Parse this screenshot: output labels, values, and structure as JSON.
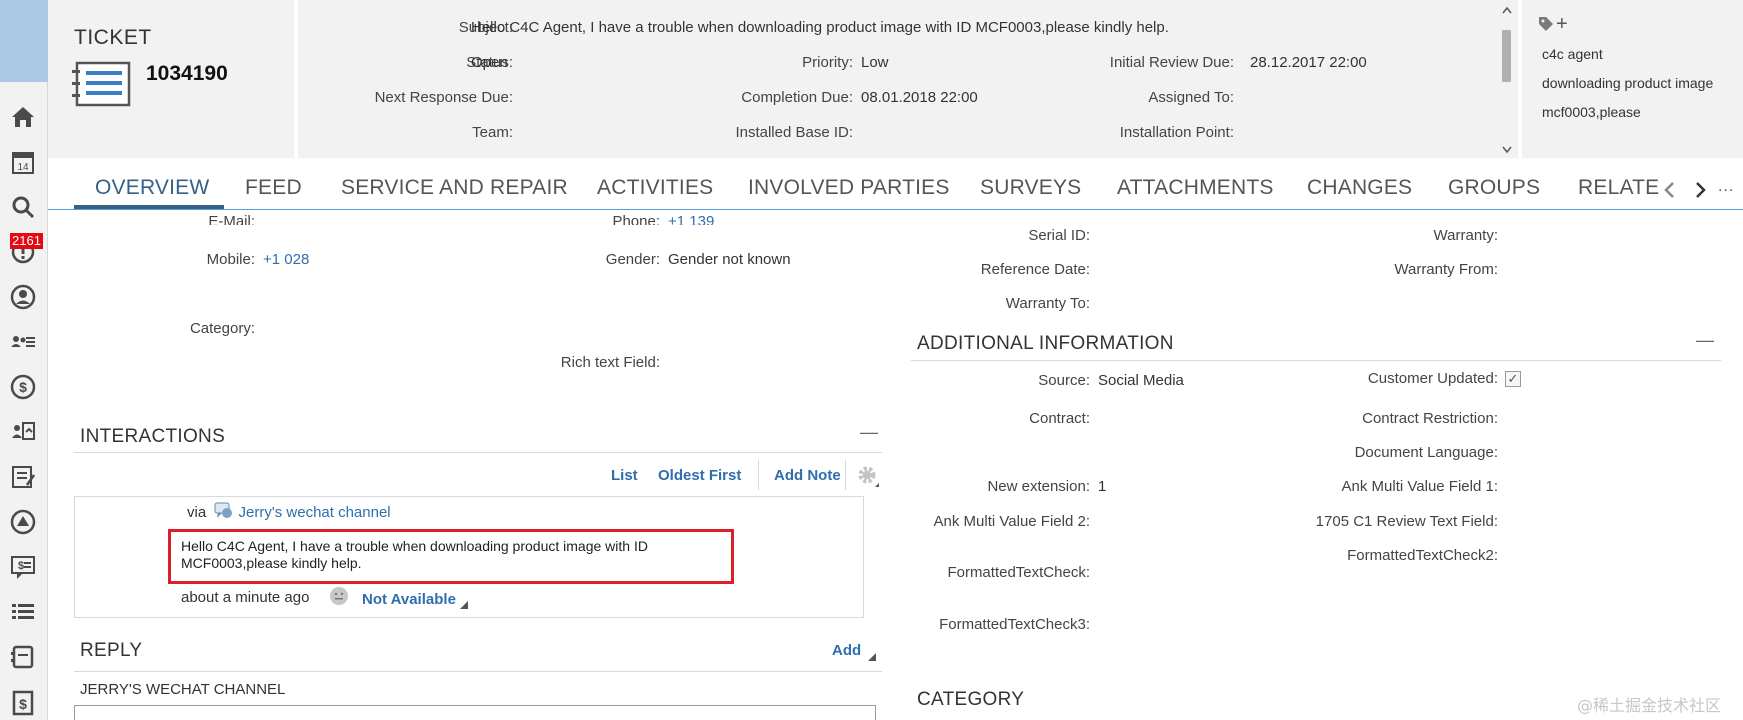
{
  "left_nav": {
    "badge": "2161",
    "icons": [
      "home-icon",
      "calendar-icon",
      "search-icon",
      "alert-icon",
      "account-icon",
      "contacts-list-icon",
      "currency-icon",
      "activities-icon",
      "tasks-icon",
      "service-icon",
      "quotes-icon",
      "list-icon",
      "products-icon",
      "pricing-icon"
    ],
    "calendar_day": "14"
  },
  "header": {
    "ticket_label": "TICKET",
    "ticket_id": "1034190",
    "subject_label": "Subject:",
    "subject_value": "Hello C4C Agent, I have a trouble when downloading product image with ID MCF0003,please kindly help.",
    "status_label": "Status:",
    "status_value": "Open",
    "priority_label": "Priority:",
    "priority_value": "Low",
    "initial_review_label": "Initial Review Due:",
    "initial_review_value": "28.12.2017 22:00",
    "next_response_label": "Next Response Due:",
    "completion_label": "Completion Due:",
    "completion_value": "08.01.2018 22:00",
    "assigned_label": "Assigned To:",
    "team_label": "Team:",
    "installed_base_label": "Installed Base ID:",
    "installation_point_label": "Installation Point:",
    "tags": [
      "c4c agent",
      "downloading product image",
      "mcf0003,please"
    ],
    "tag_add": "+"
  },
  "tabs": {
    "items": [
      "OVERVIEW",
      "FEED",
      "SERVICE AND REPAIR",
      "ACTIVITIES",
      "INVOLVED PARTIES",
      "SURVEYS",
      "ATTACHMENTS",
      "CHANGES",
      "GROUPS",
      "RELATE"
    ],
    "active": "OVERVIEW",
    "more": "..."
  },
  "contact": {
    "email_label": "E-Mail:",
    "phone_label": "Phone:",
    "phone_value": "+1 139",
    "mobile_label": "Mobile:",
    "mobile_value": "+1 028",
    "gender_label": "Gender:",
    "gender_value": "Gender not known",
    "category_label": "Category:",
    "rich_text_label": "Rich text Field:"
  },
  "interactions": {
    "title": "INTERACTIONS",
    "collapse": "—",
    "list": "List",
    "oldest_first": "Oldest First",
    "add_note": "Add Note",
    "via": "via",
    "channel": "Jerry's wechat channel",
    "message": "Hello C4C Agent, I have a trouble when downloading product image with ID MCF0003,please kindly help.",
    "time": "about a minute ago",
    "availability": "Not Available"
  },
  "reply": {
    "title": "REPLY",
    "add": "Add",
    "channel": "JERRY'S WECHAT CHANNEL"
  },
  "right_fields": {
    "serial_id_label": "Serial ID:",
    "warranty_label": "Warranty:",
    "reference_date_label": "Reference Date:",
    "warranty_from_label": "Warranty From:",
    "warranty_to_label": "Warranty To:"
  },
  "additional_info": {
    "title": "ADDITIONAL INFORMATION",
    "collapse": "—",
    "source_label": "Source:",
    "source_value": "Social Media",
    "customer_updated_label": "Customer Updated:",
    "customer_updated_checked": "✓",
    "contract_label": "Contract:",
    "contract_restriction_label": "Contract Restriction:",
    "document_language_label": "Document Language:",
    "new_extension_label": "New extension:",
    "new_extension_value": "1",
    "ank_multi_1_label": "Ank Multi Value Field 1:",
    "ank_multi_2_label": "Ank Multi Value Field 2:",
    "review_text_label": "1705 C1 Review Text Field:",
    "formatted_text_check2_label": "FormattedTextCheck2:",
    "formatted_text_check_label": "FormattedTextCheck:",
    "formatted_text_check3_label": "FormattedTextCheck3:"
  },
  "category_section": {
    "title": "CATEGORY"
  },
  "watermark": "@稀土掘金技术社区"
}
